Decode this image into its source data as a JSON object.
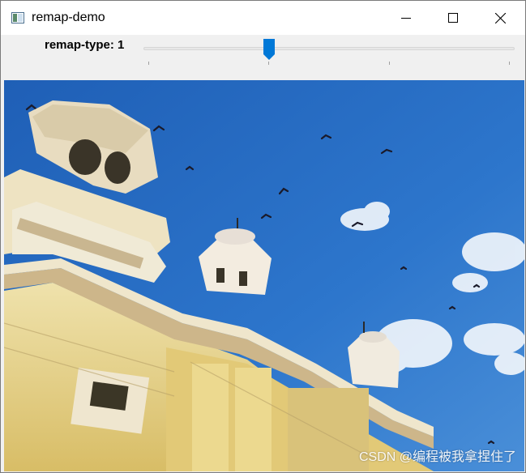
{
  "window": {
    "title": "remap-demo",
    "icon": "window-app-icon"
  },
  "toolbar": {
    "trackbar_label": "remap-type: 1",
    "trackbar": {
      "min": 0,
      "max": 3,
      "value": 1
    }
  },
  "image": {
    "description_icon": "photo",
    "watermark": "CSDN @编程被我拿捏住了"
  },
  "colors": {
    "sky": "#2a6fc4",
    "slider_thumb": "#0078d7",
    "building": "#e6cf84"
  }
}
